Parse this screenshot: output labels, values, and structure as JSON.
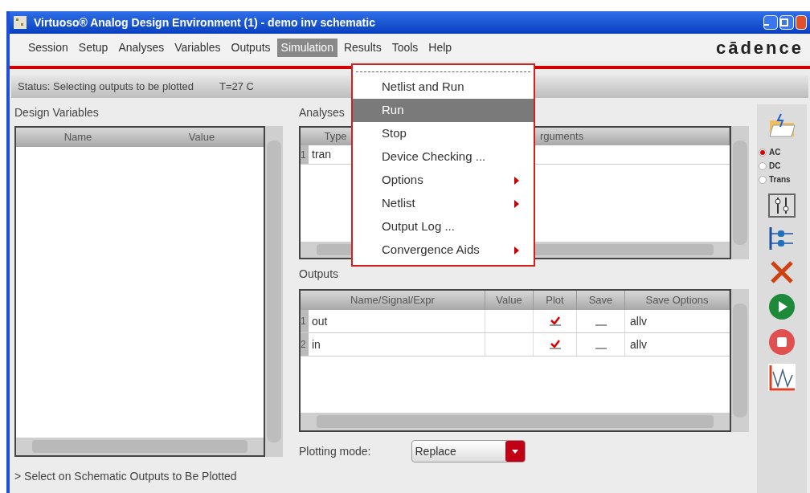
{
  "window": {
    "title": "Virtuoso® Analog Design Environment (1) - demo inv schematic"
  },
  "menu_bar": [
    {
      "label": "Session",
      "selected": false
    },
    {
      "label": "Setup",
      "selected": false
    },
    {
      "label": "Analyses",
      "selected": false
    },
    {
      "label": "Variables",
      "selected": false
    },
    {
      "label": "Outputs",
      "selected": false
    },
    {
      "label": "Simulation",
      "selected": true
    },
    {
      "label": "Results",
      "selected": false
    },
    {
      "label": "Tools",
      "selected": false
    },
    {
      "label": "Help",
      "selected": false
    }
  ],
  "brand": "cādence",
  "status_bar": {
    "status": "Status: Selecting outputs to be plotted",
    "temperature": "T=27 C"
  },
  "design_variables": {
    "title": "Design Variables",
    "columns": [
      "Name",
      "Value"
    ]
  },
  "analyses": {
    "title": "Analyses",
    "columns": [
      "Type",
      "rguments"
    ],
    "rows": [
      {
        "index": "1",
        "type": "tran"
      }
    ]
  },
  "outputs": {
    "title": "Outputs",
    "columns": [
      "Name/Signal/Expr",
      "Value",
      "Plot",
      "Save",
      "Save Options"
    ],
    "rows": [
      {
        "index": "1",
        "name": "out",
        "plot": true,
        "save": false,
        "save_options": "allv"
      },
      {
        "index": "2",
        "name": "in",
        "plot": true,
        "save": false,
        "save_options": "allv"
      }
    ]
  },
  "plotting_mode": {
    "label": "Plotting mode:",
    "value": "Replace"
  },
  "prompt": "> Select on Schematic Outputs to Be Plotted",
  "analysis_radios": [
    {
      "label": "AC",
      "selected": true
    },
    {
      "label": "DC",
      "selected": false
    },
    {
      "label": "Trans",
      "selected": false
    }
  ],
  "simulation_menu": [
    {
      "label": "Netlist and Run",
      "selected": false,
      "submenu": false
    },
    {
      "label": "Run",
      "selected": true,
      "submenu": false
    },
    {
      "label": "Stop",
      "selected": false,
      "submenu": false
    },
    {
      "label": "Device Checking ...",
      "selected": false,
      "submenu": false
    },
    {
      "label": "Options",
      "selected": false,
      "submenu": true
    },
    {
      "label": "Netlist",
      "selected": false,
      "submenu": true
    },
    {
      "label": "Output Log ...",
      "selected": false,
      "submenu": false
    },
    {
      "label": "Convergence Aids",
      "selected": false,
      "submenu": true
    }
  ]
}
